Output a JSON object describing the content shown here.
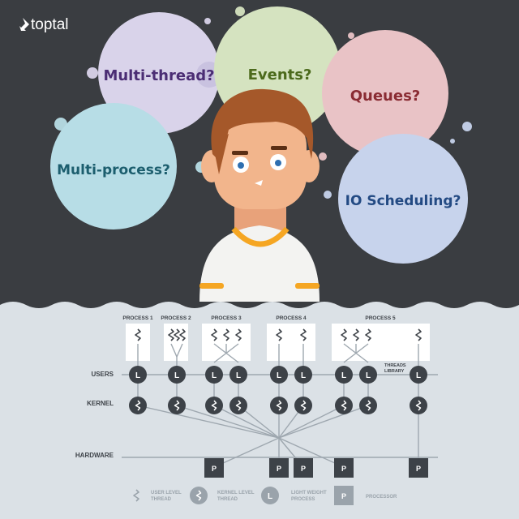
{
  "brand": {
    "logo_text": "toptal"
  },
  "bubbles": [
    {
      "text": "Multi-thread?",
      "fill": "#d9d3ea",
      "text_color": "#4b2d74"
    },
    {
      "text": "Events?",
      "fill": "#d5e3c0",
      "text_color": "#4c6a1c"
    },
    {
      "text": "Queues?",
      "fill": "#e9c3c6",
      "text_color": "#8a2c33"
    },
    {
      "text": "Multi-process?",
      "fill": "#b7dde6",
      "text_color": "#1c5e6e"
    },
    {
      "text": "IO Scheduling?",
      "fill": "#c7d3ec",
      "text_color": "#234a83"
    }
  ],
  "diagram": {
    "processes": [
      "PROCESS 1",
      "PROCESS 2",
      "PROCESS 3",
      "PROCESS 4",
      "PROCESS 5"
    ],
    "row_labels": {
      "users": "USERS",
      "kernel": "KERNEL",
      "hardware": "HARDWARE"
    },
    "threads_library": [
      "THREADS",
      "LIBRARY"
    ],
    "lwp_letter": "L",
    "processor_letter": "P"
  },
  "legend": {
    "user_thread": [
      "USER LEVEL",
      "THREAD"
    ],
    "kernel_thread": [
      "KERNEL LEVEL",
      "THREAD"
    ],
    "lwp": [
      "LIGHT WEIGHT",
      "PROCESS"
    ],
    "processor": "PROCESSOR"
  },
  "colors": {
    "background_dark": "#3a3d41",
    "background_light": "#dbe1e6",
    "node_dark": "#3d4248",
    "line_grey": "#9ea7af",
    "skin": "#f2b58c",
    "hair": "#a5582a",
    "collar": "#f5a623"
  }
}
